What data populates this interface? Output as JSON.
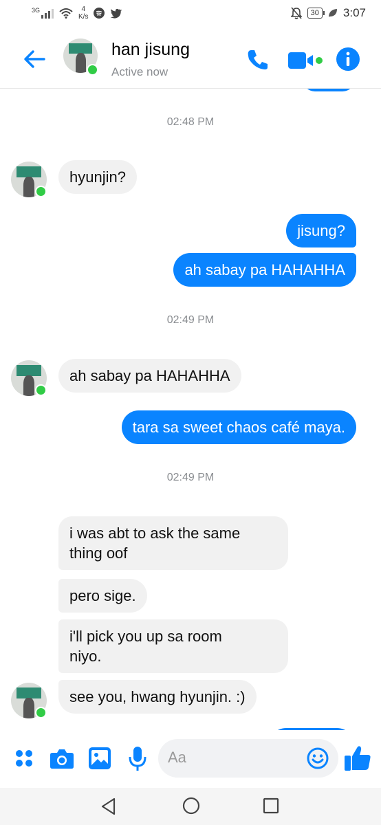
{
  "status_bar": {
    "network": "3G",
    "speed_value": "4",
    "speed_unit": "K/s",
    "battery": "30",
    "time": "3:07",
    "icons": [
      "signal-icon",
      "wifi-icon",
      "spotify-icon",
      "twitter-icon",
      "mute-icon",
      "battery-icon",
      "leaf-icon"
    ]
  },
  "header": {
    "name": "han jisung",
    "status": "Active now",
    "icons": [
      "back-arrow-icon",
      "phone-icon",
      "video-icon",
      "info-icon"
    ]
  },
  "messages": {
    "ts1": "02:48 PM",
    "m1": "hyunjin?",
    "m2": "jisung?",
    "m3": "ah sabay pa HAHAHHA",
    "ts2": "02:49 PM",
    "m4": "ah sabay pa HAHAHHA",
    "m5": "tara sa sweet chaos café maya.",
    "ts3": "02:49 PM",
    "m6a": "i was abt to ask the same",
    "m6b": "thing oof",
    "m7": "pero sige.",
    "m8a": "i'll pick you up sa room",
    "m8b": "niyo.",
    "m9": "see you, hwang hyunjin. :)"
  },
  "composer": {
    "placeholder": "Aa",
    "icons": [
      "menu-grid-icon",
      "camera-icon",
      "image-icon",
      "mic-icon",
      "emoji-icon",
      "like-icon"
    ]
  },
  "colors": {
    "accent": "#0a84ff",
    "incoming": "#f1f1f1",
    "presence": "#31cc46"
  }
}
